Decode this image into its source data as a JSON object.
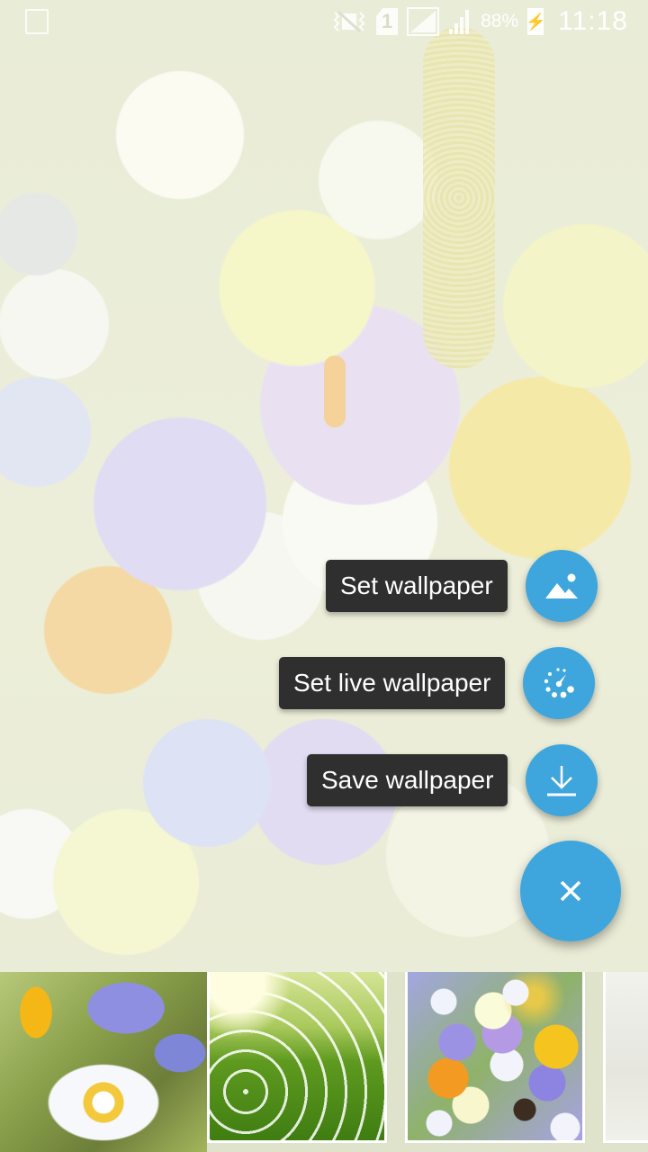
{
  "status_bar": {
    "notification_icon": "gallery-notification-icon",
    "icons": [
      "vibrate-icon",
      "sim-1-icon",
      "signal-roaming-icon",
      "signal-icon"
    ],
    "sim_label": "1",
    "battery_percent": "88%",
    "battery_state": "charging",
    "time": "11:18"
  },
  "fab_menu": {
    "accent_color": "#3ea6dc",
    "label_bg_color": "#2f2f2f",
    "actions": [
      {
        "label": "Set wallpaper",
        "icon": "image-icon"
      },
      {
        "label": "Set live wallpaper",
        "icon": "live-wallpaper-dial-icon"
      },
      {
        "label": "Save wallpaper",
        "icon": "download-icon"
      }
    ],
    "close_icon": "close-icon"
  },
  "thumbnails": [
    {
      "name": "white-anemone-bluebells"
    },
    {
      "name": "sunlit-meadow-daisies"
    },
    {
      "name": "mixed-spring-flowers",
      "selected": true
    },
    {
      "name": "white-towels"
    }
  ]
}
